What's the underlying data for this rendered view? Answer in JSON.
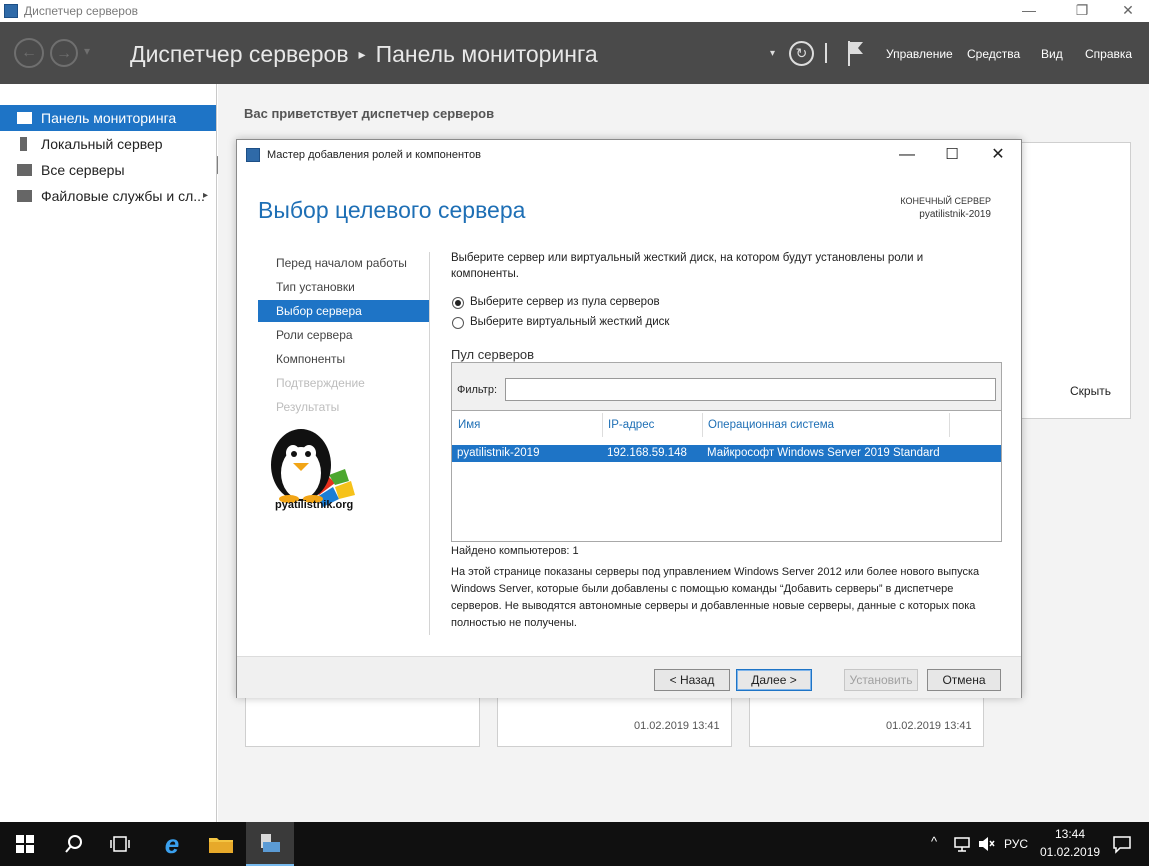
{
  "window": {
    "title": "Диспетчер серверов",
    "min": "—",
    "restore": "❐",
    "close": "✕"
  },
  "header": {
    "back": "←",
    "forward": "→",
    "dropdown": "▾",
    "breadcrumb_app": "Диспетчер серверов",
    "breadcrumb_sep": "▸",
    "breadcrumb_page": "Панель мониторинга",
    "refresh": "↻",
    "menu": [
      "Управление",
      "Средства",
      "Вид",
      "Справка"
    ]
  },
  "sidebar": {
    "items": [
      {
        "label": "Панель мониторинга",
        "icon": "dashboard-icon",
        "active": true
      },
      {
        "label": "Локальный сервер",
        "icon": "server-icon"
      },
      {
        "label": "Все серверы",
        "icon": "servers-icon"
      },
      {
        "label": "Файловые службы и сл...",
        "icon": "file-services-icon",
        "arrow": "▸"
      }
    ]
  },
  "main": {
    "welcome": "Вас приветствует диспетчер серверов",
    "hide": "Скрыть",
    "tile_dates": [
      "01.02.2019 13:41",
      "01.02.2019 13:41"
    ]
  },
  "dialog": {
    "title": "Мастер добавления ролей и компонентов",
    "heading": "Выбор целевого сервера",
    "dest_label": "КОНЕЧНЫЙ СЕРВЕР",
    "dest_server": "pyatilistnik-2019",
    "steps": [
      {
        "label": "Перед началом работы",
        "state": "normal"
      },
      {
        "label": "Тип установки",
        "state": "normal"
      },
      {
        "label": "Выбор сервера",
        "state": "active"
      },
      {
        "label": "Роли сервера",
        "state": "normal"
      },
      {
        "label": "Компоненты",
        "state": "normal"
      },
      {
        "label": "Подтверждение",
        "state": "disabled"
      },
      {
        "label": "Результаты",
        "state": "disabled"
      }
    ],
    "logo_text": "pyatilistnik.org",
    "description": "Выберите сервер или виртуальный жесткий диск, на котором будут установлены роли и компоненты.",
    "radio_pool": "Выберите сервер из пула серверов",
    "radio_vhd": "Выберите виртуальный жесткий диск",
    "pool_label": "Пул серверов",
    "filter_label": "Фильтр:",
    "filter_value": "",
    "columns": [
      "Имя",
      "IP-адрес",
      "Операционная система"
    ],
    "rows": [
      {
        "name": "pyatilistnik-2019",
        "ip": "192.168.59.148",
        "os": "Майкрософт Windows Server 2019 Standard"
      }
    ],
    "found": "Найдено компьютеров: 1",
    "note": "На этой странице показаны серверы под управлением Windows Server 2012 или более нового выпуска Windows Server, которые были добавлены с помощью команды “Добавить серверы” в диспетчере серверов. Не выводятся автономные серверы и добавленные новые серверы, данные с которых пока полностью не получены.",
    "buttons": {
      "back": "< Назад",
      "next": "Далее >",
      "install": "Установить",
      "cancel": "Отмена"
    }
  },
  "taskbar": {
    "lang": "РУС",
    "time": "13:44",
    "date": "01.02.2019",
    "icons": [
      "windows-start-icon",
      "search-icon",
      "task-view-icon",
      "internet-explorer-icon",
      "file-explorer-icon",
      "server-manager-icon"
    ]
  },
  "colors": {
    "accent": "#1e74c6",
    "header": "#4a4a4a",
    "taskbar": "#101010"
  }
}
